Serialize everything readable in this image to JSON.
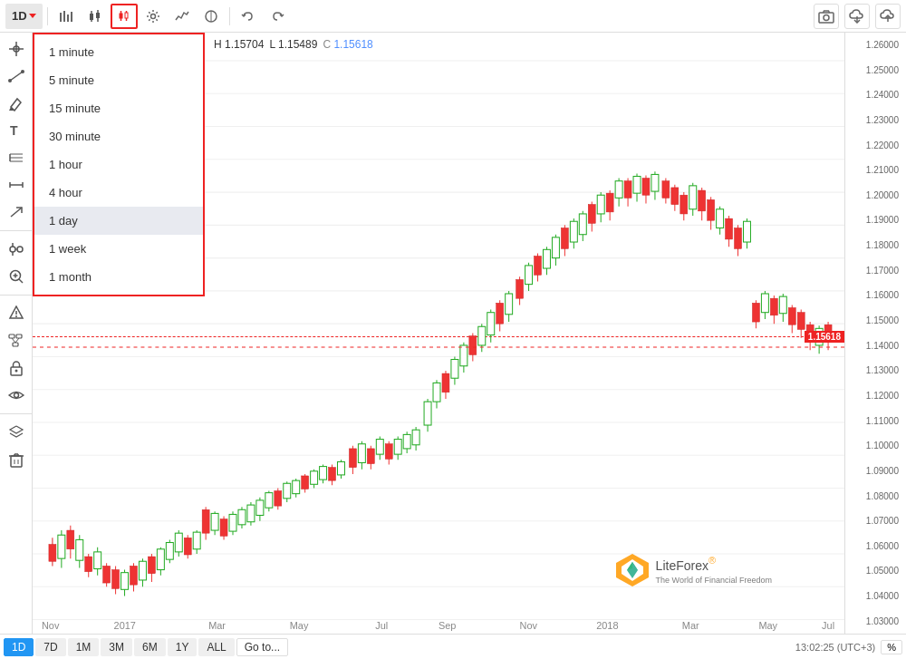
{
  "toolbar": {
    "timeframe_label": "1D",
    "dropdown_arrow_label": "▾",
    "tools": [
      "bar-chart-icon",
      "candle-icon",
      "settings-icon",
      "indicators-icon",
      "compare-icon",
      "undo-icon",
      "redo-icon"
    ],
    "right_btns": [
      "camera-icon",
      "cloud-download-icon",
      "cloud-upload-icon"
    ]
  },
  "dropdown": {
    "items": [
      {
        "label": "1 minute",
        "value": "1m",
        "selected": false
      },
      {
        "label": "5 minute",
        "value": "5m",
        "selected": false
      },
      {
        "label": "15 minute",
        "value": "15m",
        "selected": false
      },
      {
        "label": "30 minute",
        "value": "30m",
        "selected": false
      },
      {
        "label": "1 hour",
        "value": "1h",
        "selected": false
      },
      {
        "label": "4 hour",
        "value": "4h",
        "selected": false
      },
      {
        "label": "1 day",
        "value": "1d",
        "selected": true
      },
      {
        "label": "1 week",
        "value": "1w",
        "selected": false
      },
      {
        "label": "1 month",
        "value": "1mo",
        "selected": false
      }
    ]
  },
  "ohlc": {
    "high_label": "H",
    "high_val": "1.15704",
    "low_label": "L",
    "low_val": "1.15489",
    "close_label": "C",
    "close_val": "1.15618"
  },
  "price_axis": {
    "levels": [
      "1.26000",
      "1.25000",
      "1.24000",
      "1.23000",
      "1.22000",
      "1.21000",
      "1.20000",
      "1.19000",
      "1.18000",
      "1.17000",
      "1.16000",
      "1.15000",
      "1.14000",
      "1.13000",
      "1.12000",
      "1.11000",
      "1.10000",
      "1.09000",
      "1.08000",
      "1.07000",
      "1.06000",
      "1.05000",
      "1.04000",
      "1.03000"
    ],
    "current": "1.15618",
    "current_color": "#e22"
  },
  "bottom_bar": {
    "timeframes": [
      "1D",
      "7D",
      "1M",
      "3M",
      "6M",
      "1Y",
      "ALL"
    ],
    "active": "1D",
    "goto_label": "Go to...",
    "time_display": "13:02:25 (UTC+3)",
    "pct_label": "%"
  },
  "watermark": {
    "brand": "LiteForex",
    "registered": "®",
    "tagline": "The World of Financial Freedom"
  },
  "x_axis_labels": [
    "Nov",
    "2017",
    "Mar",
    "May",
    "Jul",
    "Sep",
    "Nov",
    "2018",
    "Mar",
    "May",
    "Jul"
  ]
}
